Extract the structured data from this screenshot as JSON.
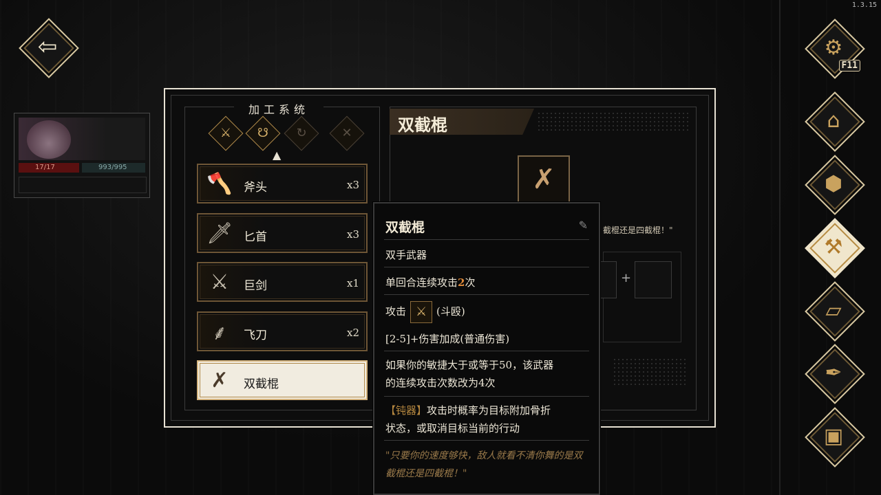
{
  "version": "1.3.15",
  "nav": {
    "back_icon": "arrow-left-icon",
    "settings_hotkey": "F11"
  },
  "character": {
    "hp": "17/17",
    "mp": "993/995"
  },
  "crafting": {
    "title": "加工系统",
    "items": [
      {
        "name": "斧头",
        "count": "x3",
        "icon": "axe-icon"
      },
      {
        "name": "匕首",
        "count": "x3",
        "icon": "dagger-icon"
      },
      {
        "name": "巨剑",
        "count": "x1",
        "icon": "greatsword-icon"
      },
      {
        "name": "飞刀",
        "count": "x2",
        "icon": "throwing-knife-icon"
      },
      {
        "name": "双截棍",
        "count": "",
        "icon": "nunchaku-icon"
      }
    ]
  },
  "detail": {
    "title": "双截棍",
    "quote_partial": "截棍还是四截棍！\"",
    "plus": "+"
  },
  "tooltip": {
    "name": "双截棍",
    "type": "双手武器",
    "combo_prefix": "单回合连续攻击",
    "combo_value": "2",
    "combo_suffix": "次",
    "attack_label": "攻击",
    "attack_type": "(斗殴)",
    "damage": "[2-5]+伤害加成(普通伤害)",
    "agility_line1": "如果你的敏捷大于或等于50，该武器",
    "agility_line2": "的连续攻击次数改为4次",
    "blunt_tag": "【钝器】",
    "blunt_line1": "攻击时概率为目标附加骨折",
    "blunt_line2": "状态，或取消目标当前的行动",
    "quote": "\"只要你的速度够快，敌人就看不清你舞的是双截棍还是四截棍！\""
  },
  "colors": {
    "accent": "#d9c9a2",
    "highlight": "#e08a3a",
    "quote": "#9a7a4a"
  }
}
